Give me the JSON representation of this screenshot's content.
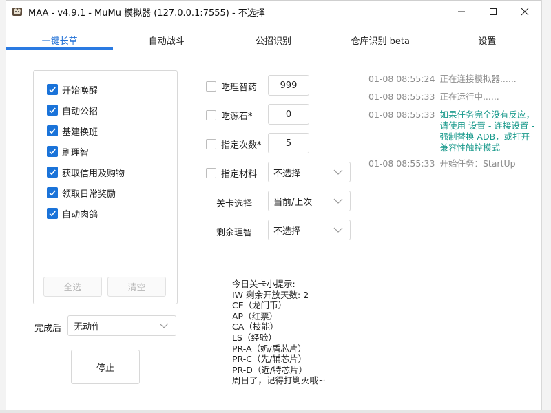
{
  "window": {
    "title": "MAA - v4.9.1 - MuMu 模拟器 (127.0.0.1:7555) - 不选择",
    "icon": "maa-app-icon"
  },
  "tabs": [
    {
      "label": "一键长草",
      "active": true
    },
    {
      "label": "自动战斗"
    },
    {
      "label": "公招识别"
    },
    {
      "label": "仓库识别 beta"
    },
    {
      "label": "设置"
    }
  ],
  "tasks": [
    {
      "label": "开始唤醒",
      "checked": true
    },
    {
      "label": "自动公招",
      "checked": true
    },
    {
      "label": "基建换班",
      "checked": true
    },
    {
      "label": "刷理智",
      "checked": true
    },
    {
      "label": "获取信用及购物",
      "checked": true
    },
    {
      "label": "领取日常奖励",
      "checked": true
    },
    {
      "label": "自动肉鸽",
      "checked": true
    }
  ],
  "task_buttons": {
    "select_all": "全选",
    "clear": "清空"
  },
  "finish": {
    "label": "完成后",
    "value": "无动作"
  },
  "stop_button": "停止",
  "options": {
    "medicine": {
      "label": "吃理智药",
      "value": "999"
    },
    "stone": {
      "label": "吃源石*",
      "value": "0"
    },
    "times": {
      "label": "指定次数*",
      "value": "5"
    },
    "material": {
      "label": "指定材料",
      "value": "不选择"
    },
    "stage": {
      "label": "关卡选择",
      "value": "当前/上次"
    },
    "remaining": {
      "label": "剩余理智",
      "value": "不选择"
    }
  },
  "tips": "今日关卡小提示:\nIW 剩余开放天数: 2\nCE（龙门币）\nAP（红票）\nCA（技能）\nLS（经验）\nPR-A（奶/盾芯片）\nPR-C（先/辅芯片）\nPR-D（近/特芯片）\n周日了，记得打剿灭哦~",
  "log": [
    {
      "time": "01-08  08:55:24",
      "message": "正在连接模拟器......"
    },
    {
      "time": "01-08  08:55:33",
      "message": "正在运行中......"
    },
    {
      "time": "01-08  08:55:33",
      "message": "如果任务完全没有反应，请使用 设置 - 连接设置 - 强制替换 ADB，或打开兼容性触控模式",
      "warn": true
    },
    {
      "time": "01-08  08:55:33",
      "message": "开始任务：StartUp"
    }
  ],
  "colors": {
    "accent": "#2a7ae2",
    "warn": "#1a9a8c",
    "muted": "#8c8c8c"
  }
}
